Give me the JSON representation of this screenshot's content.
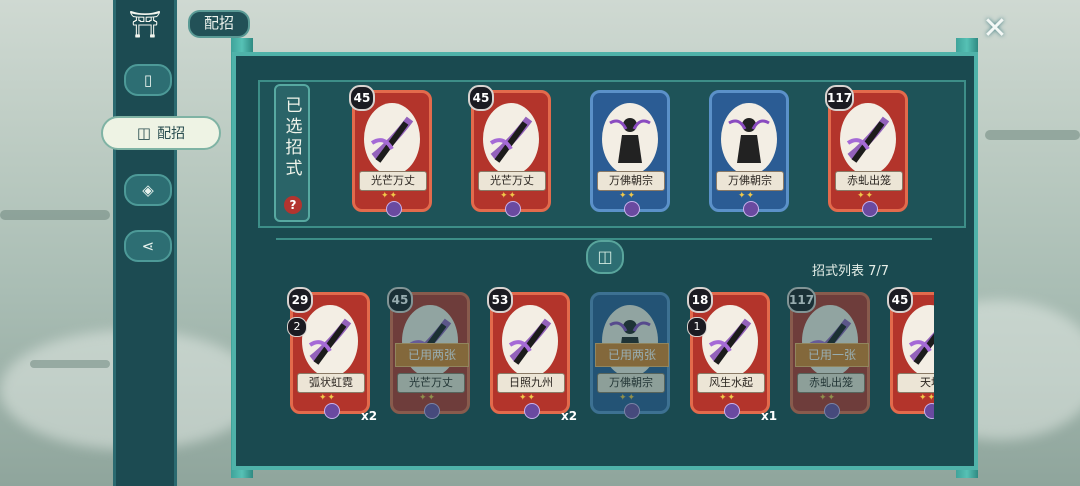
{
  "header": {
    "title": "配招"
  },
  "nav": {
    "active_label": "配招"
  },
  "selected": {
    "label": "已选招式",
    "help": "?",
    "cards": [
      {
        "cost": "45",
        "name": "光芒万丈",
        "color": "red"
      },
      {
        "cost": "45",
        "name": "光芒万丈",
        "color": "red"
      },
      {
        "cost": "",
        "name": "万佛朝宗",
        "color": "blue"
      },
      {
        "cost": "",
        "name": "万佛朝宗",
        "color": "blue"
      },
      {
        "cost": "117",
        "name": "赤虬出笼",
        "color": "red"
      }
    ]
  },
  "list": {
    "count_text": "招式列表  7/7",
    "cards": [
      {
        "cost": "29",
        "count": "2",
        "name": "弧状虹霓",
        "color": "red",
        "mult": "x2",
        "used": ""
      },
      {
        "cost": "45",
        "count": "",
        "name": "光芒万丈",
        "color": "red",
        "mult": "",
        "used": "已用两张"
      },
      {
        "cost": "53",
        "count": "",
        "name": "日照九州",
        "color": "red",
        "mult": "x2",
        "used": ""
      },
      {
        "cost": "",
        "count": "",
        "name": "万佛朝宗",
        "color": "blue",
        "mult": "",
        "used": "已用两张"
      },
      {
        "cost": "18",
        "count": "1",
        "name": "风生水起",
        "color": "red",
        "mult": "x1",
        "used": ""
      },
      {
        "cost": "117",
        "count": "",
        "name": "赤虬出笼",
        "color": "red",
        "mult": "",
        "used": "已用一张"
      },
      {
        "cost": "45",
        "count": "",
        "name": "天地",
        "color": "red",
        "mult": "",
        "used": ""
      }
    ]
  },
  "colors": {
    "panel": "#1a4a50",
    "accent": "#4fb2a9",
    "card_red": "#b3342b",
    "card_blue": "#2b5c94",
    "used_tag": "#d9822b"
  }
}
